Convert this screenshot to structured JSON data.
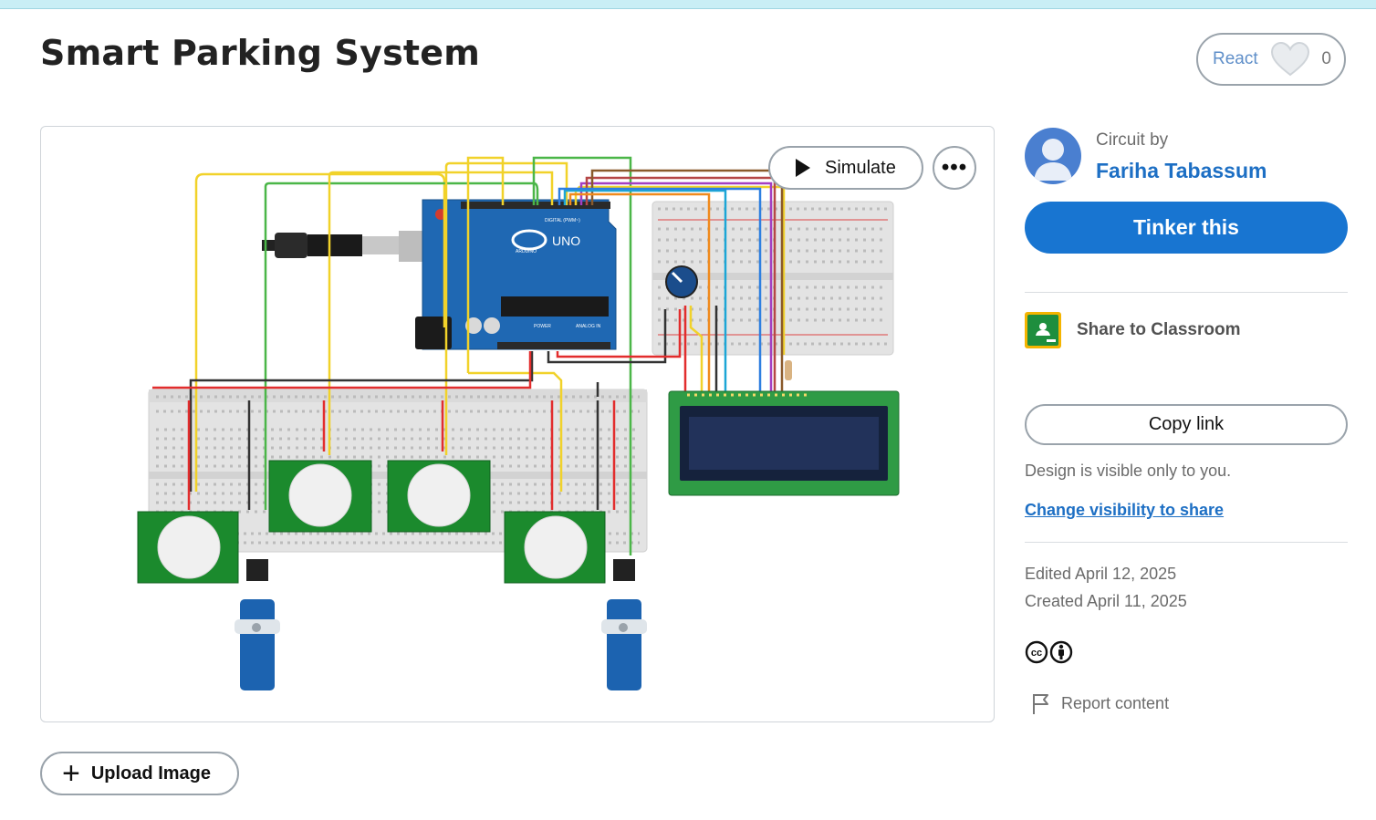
{
  "page": {
    "title": "Smart Parking System"
  },
  "react": {
    "label": "React",
    "count": "0",
    "icon": "heart-icon"
  },
  "canvas": {
    "simulate_label": "Simulate",
    "more_label": "•••",
    "board_labels": {
      "brand": "ARDUINO",
      "model": "UNO",
      "digital": "DIGITAL (PWM~)",
      "power": "POWER",
      "analog": "ANALOG IN"
    }
  },
  "upload": {
    "label": "Upload Image",
    "icon": "plus-icon"
  },
  "author": {
    "prefix": "Circuit by",
    "name": "Fariha Tabassum"
  },
  "actions": {
    "tinker_label": "Tinker this",
    "classroom_label": "Share to Classroom",
    "copy_label": "Copy link",
    "visibility_text": "Design is visible only to you.",
    "visibility_link": "Change visibility to share"
  },
  "meta": {
    "edited": "Edited April 12, 2025",
    "created": "Created April 11, 2025",
    "license_icons": [
      "cc-icon",
      "attribution-icon"
    ],
    "report_label": "Report content"
  },
  "colors": {
    "accent": "#1875d1",
    "link": "#1d6fc4",
    "board_blue": "#1f68b3",
    "pcb_green": "#2e8b3e"
  }
}
